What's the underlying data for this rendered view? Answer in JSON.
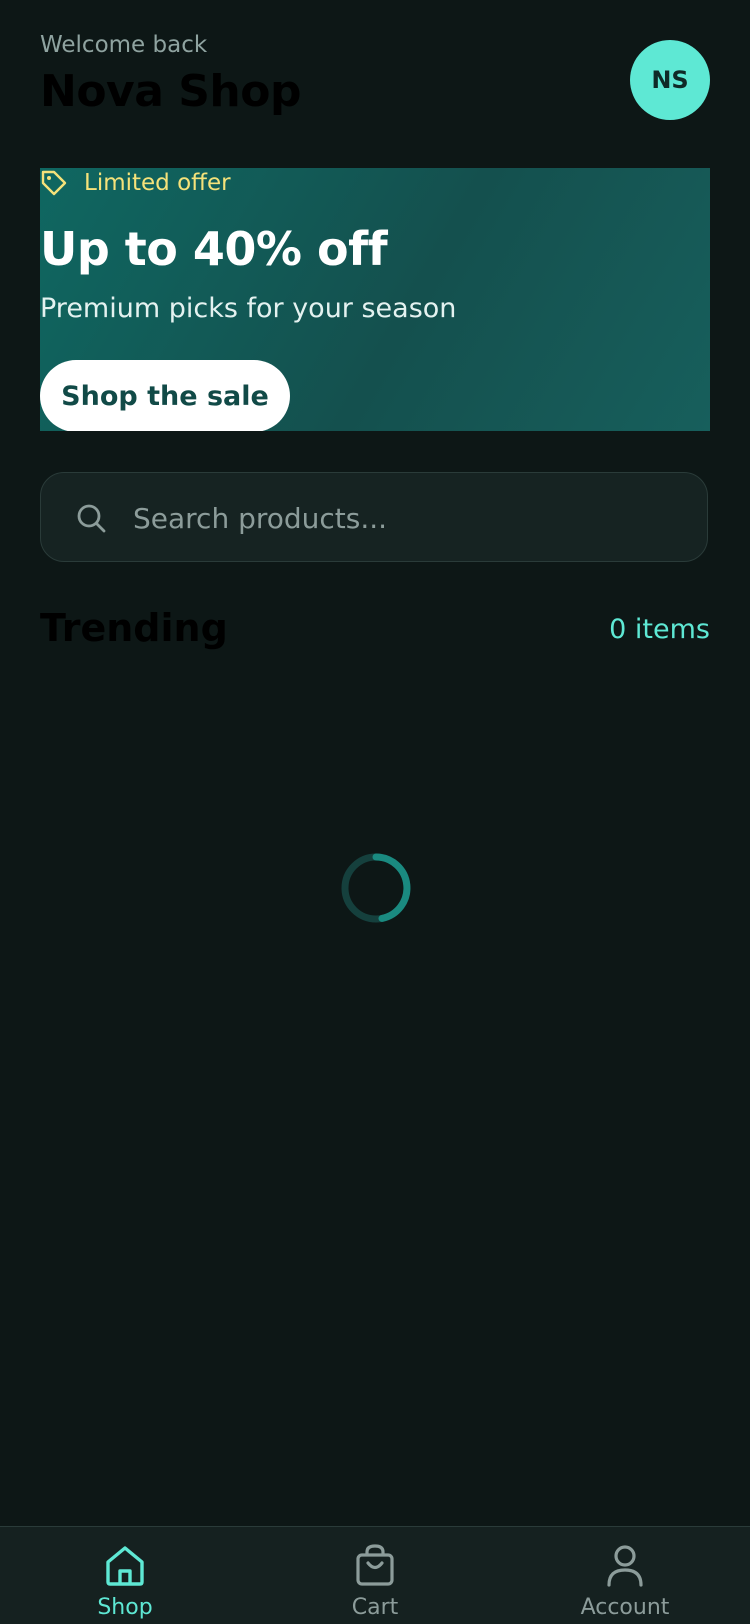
{
  "header": {
    "greeting": "Welcome back",
    "shop_name": "Nova Shop",
    "avatar_initials": "NS"
  },
  "banner": {
    "offer_label": "Limited offer",
    "title": "Up to 40% off",
    "subtitle": "Premium picks for your season",
    "button_label": "Shop the sale"
  },
  "search": {
    "placeholder": "Search products...",
    "value": ""
  },
  "trending": {
    "title": "Trending",
    "count": "0 items"
  },
  "bottom_nav": {
    "items": [
      {
        "label": "Shop",
        "icon": "home-icon",
        "active": true
      },
      {
        "label": "Cart",
        "icon": "shopping-bag-icon",
        "active": false
      },
      {
        "label": "Account",
        "icon": "user-icon",
        "active": false
      }
    ]
  },
  "colors": {
    "background": "#0d1716",
    "accent": "#5ee8d4",
    "banner_start": "#0f6761",
    "banner_end": "#14504e",
    "offer_text": "#f5e27a",
    "inactive_nav": "#8c9c9a"
  }
}
